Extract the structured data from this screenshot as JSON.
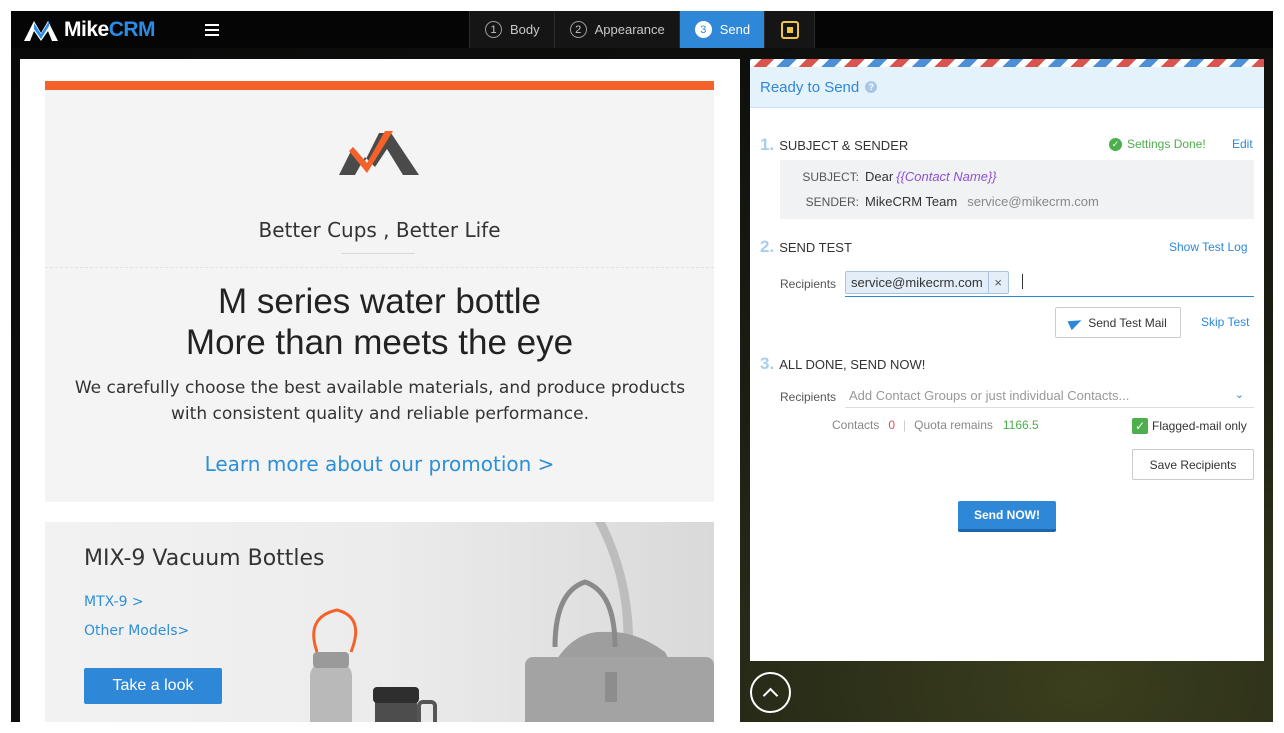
{
  "app": {
    "logo_text_main": "Mike",
    "logo_text_accent": "CRM"
  },
  "steps": [
    {
      "num": "1",
      "label": "Body"
    },
    {
      "num": "2",
      "label": "Appearance"
    },
    {
      "num": "3",
      "label": "Send"
    }
  ],
  "email": {
    "tagline": "Better Cups ,  Better Life",
    "headline_line1": "M series water bottle",
    "headline_line2": "More than meets the eye",
    "subcopy": "We carefully choose the best available materials, and produce products with consistent quality and reliable performance.",
    "promo_link": "Learn more about our promotion >",
    "product_title": "MIX-9 Vacuum Bottles",
    "product_link1": "MTX-9 >",
    "product_link2": "Other Models>",
    "take_look": "Take a look"
  },
  "panel": {
    "ready_title": "Ready to Send",
    "help_glyph": "?",
    "section1": {
      "num": "1.",
      "title": "SUBJECT & SENDER",
      "status": "Settings Done!",
      "edit": "Edit"
    },
    "subject": {
      "label": "SUBJECT:",
      "text": "Dear",
      "variable": "{{Contact Name}}"
    },
    "sender": {
      "label": "SENDER:",
      "name": "MikeCRM Team",
      "email": "service@mikecrm.com"
    },
    "section2": {
      "num": "2.",
      "title": "SEND TEST",
      "log_link": "Show Test Log"
    },
    "test_recipients_label": "Recipients",
    "test_recipient": "service@mikecrm.com",
    "remove_glyph": "×",
    "send_test_btn": "Send Test Mail",
    "skip_test": "Skip Test",
    "section3": {
      "num": "3.",
      "title": "ALL DONE, SEND NOW!"
    },
    "recipients_label": "Recipients",
    "recipients_placeholder": "Add Contact Groups or just individual Contacts...",
    "contacts_label": "Contacts",
    "contacts_value": "0",
    "separator": "|",
    "quota_label": "Quota remains",
    "quota_value": "1166.5",
    "flagged_label": "Flagged-mail only",
    "flagged_checked": true,
    "save_recipients": "Save Recipients",
    "send_now": "Send NOW!"
  },
  "colors": {
    "accent": "#2f88d7",
    "brand_orange": "#f4622a",
    "success": "#4cae4c",
    "variable": "#8e4fd6",
    "danger": "#d9534f"
  }
}
